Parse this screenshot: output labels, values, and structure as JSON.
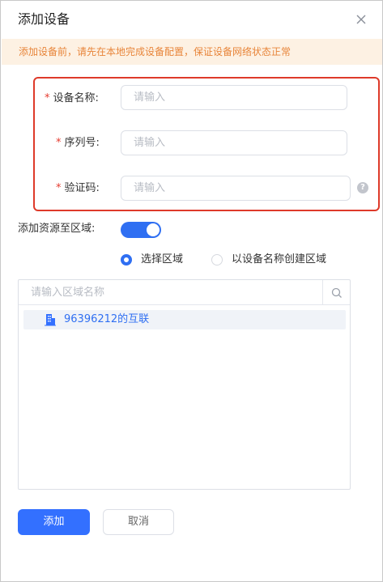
{
  "dialog": {
    "title": "添加设备",
    "close_icon": "close-icon",
    "notice": "添加设备前，请先在本地完成设备配置，保证设备网络状态正常"
  },
  "form": {
    "required_mark": "*",
    "device_name": {
      "label": "设备名称:",
      "placeholder": "请输入",
      "value": ""
    },
    "serial_number": {
      "label": "序列号:",
      "placeholder": "请输入",
      "value": ""
    },
    "verify_code": {
      "label": "验证码:",
      "placeholder": "请输入",
      "value": "",
      "help_icon": "question-circle-icon",
      "help_glyph": "?"
    }
  },
  "region": {
    "toggle_label": "添加资源至区域:",
    "toggle_on": true,
    "radio_options": [
      {
        "label": "选择区域",
        "selected": true
      },
      {
        "label": "以设备名称创建区域",
        "selected": false
      }
    ],
    "search_placeholder": "请输入区域名称",
    "search_icon": "search-icon",
    "tree": [
      {
        "label": "96396212的互联",
        "icon": "building-icon"
      }
    ]
  },
  "footer": {
    "confirm_label": "添加",
    "cancel_label": "取消"
  },
  "colors": {
    "accent": "#3370ff",
    "notice_bg": "#fdf1e3",
    "notice_text": "#e8853a",
    "highlight_border": "#de3a2a",
    "required": "#e53b2f"
  }
}
